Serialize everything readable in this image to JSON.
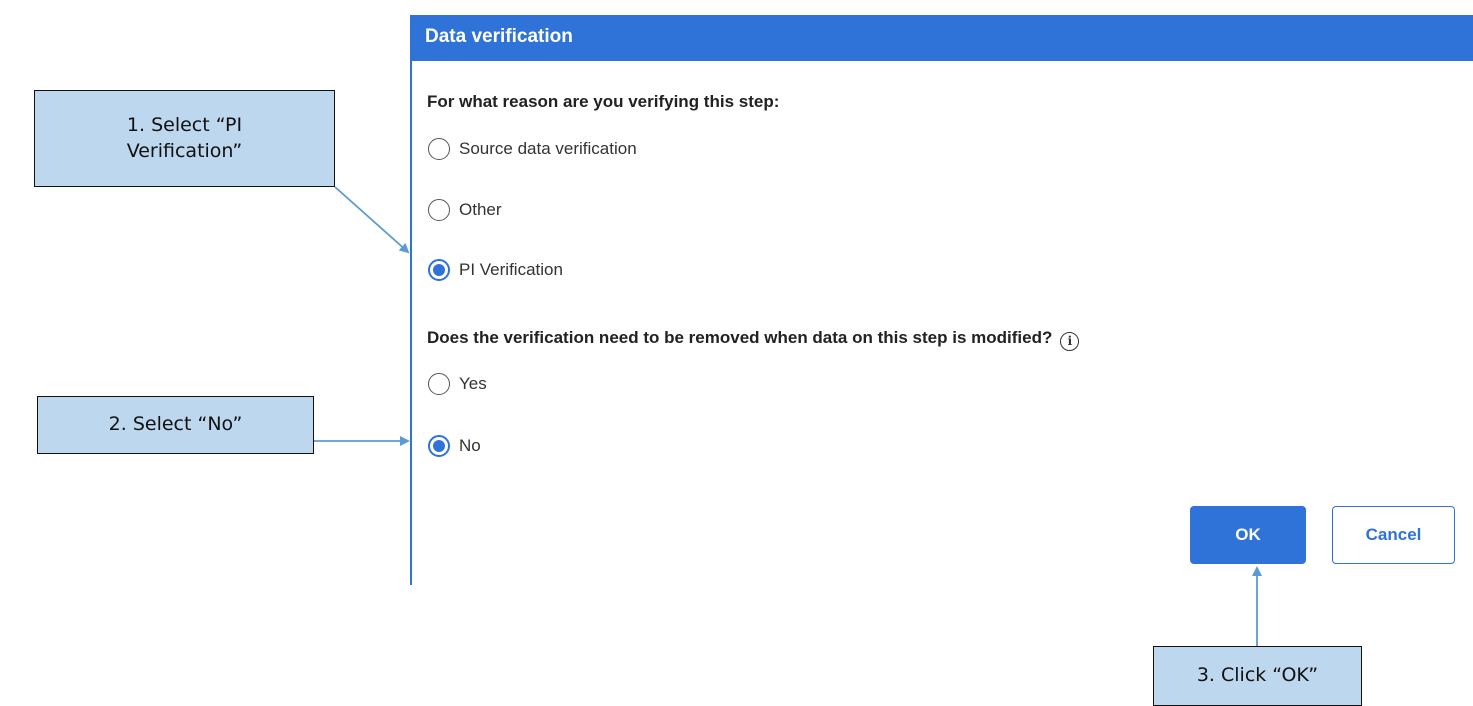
{
  "dialog": {
    "title": "Data verification",
    "question1": "For what reason are you verifying this step:",
    "reason_options": [
      {
        "label": "Source data verification",
        "checked": false
      },
      {
        "label": "Other",
        "checked": false
      },
      {
        "label": "PI Verification",
        "checked": true
      }
    ],
    "question2": "Does the verification need to be removed when data on this step is modified?",
    "info_icon": "i",
    "remove_options": [
      {
        "label": "Yes",
        "checked": false
      },
      {
        "label": "No",
        "checked": true
      }
    ],
    "ok_label": "OK",
    "cancel_label": "Cancel"
  },
  "callouts": {
    "step1": "1. Select “PI Verification”",
    "step2": "2. Select “No”",
    "step3": "3. Click “OK”"
  },
  "colors": {
    "accent": "#2f73d9",
    "callout_fill": "#bdd7ee",
    "arrow": "#5b9bd5"
  }
}
